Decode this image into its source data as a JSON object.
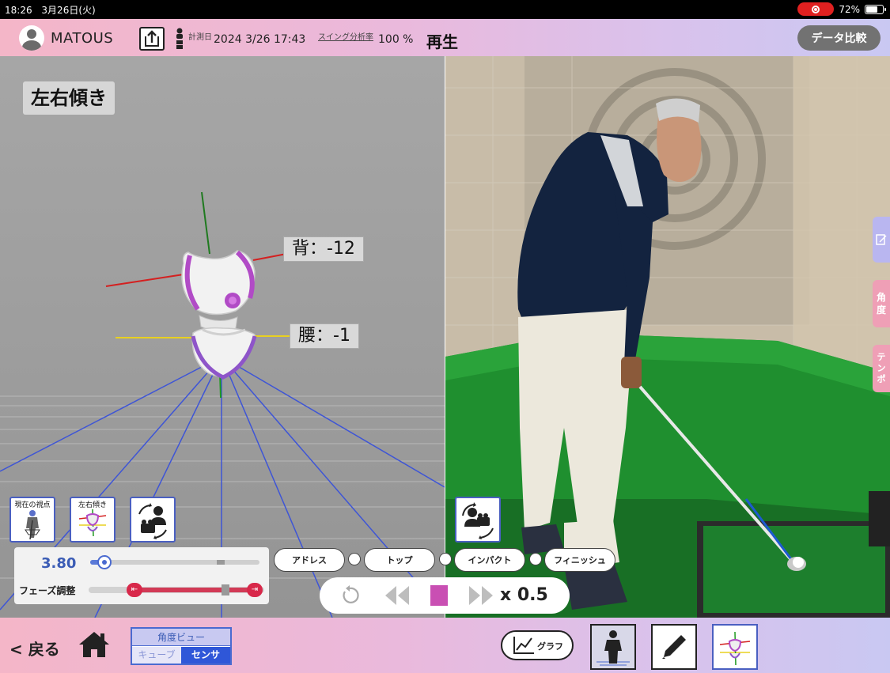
{
  "status_bar": {
    "time": "18:26",
    "date": "3月26日(火)",
    "battery": "72%",
    "battery_level": 0.72
  },
  "header": {
    "user": "MATOUS",
    "measure_label": "計測日",
    "measure_date": "2024  3/26  17:43",
    "rate_label": "スイング分析率",
    "rate_value": "100 %",
    "play_state": "再生",
    "compare_button": "データ比較"
  },
  "view3d": {
    "title": "左右傾き",
    "back_angle": "背：-12",
    "hip_angle": "腰：-1",
    "view_buttons": [
      {
        "label": "現在の視点",
        "icon": "golfer-front-icon"
      },
      {
        "label": "左右傾き",
        "icon": "sensor-tilt-icon"
      },
      {
        "label": "",
        "icon": "camera-rotate-icon"
      }
    ]
  },
  "controls": {
    "ratio_value": "3.80",
    "ratio_fraction": 0.04,
    "phase_label": "フェーズ調整",
    "phase_start_icon": "⇤",
    "phase_end_icon": "⇥"
  },
  "phases": [
    "アドレス",
    "トップ",
    "インパクト",
    "フィニッシュ"
  ],
  "playback": {
    "speed": "x 0.5"
  },
  "side_tabs": {
    "memo_icon": "edit-note-icon",
    "angle": "角\n度",
    "tempo": "テ\nン\nポ"
  },
  "bottom_bar": {
    "back": "< 戻る",
    "angle_view_title": "角度ビュー",
    "angle_view_options": [
      "キューブ",
      "センサ"
    ],
    "graph_label": "グラフ"
  },
  "colors": {
    "accent_blue": "#2f57d8",
    "phase_red": "#d8284a",
    "sensor_purple": "#b14bc6"
  }
}
